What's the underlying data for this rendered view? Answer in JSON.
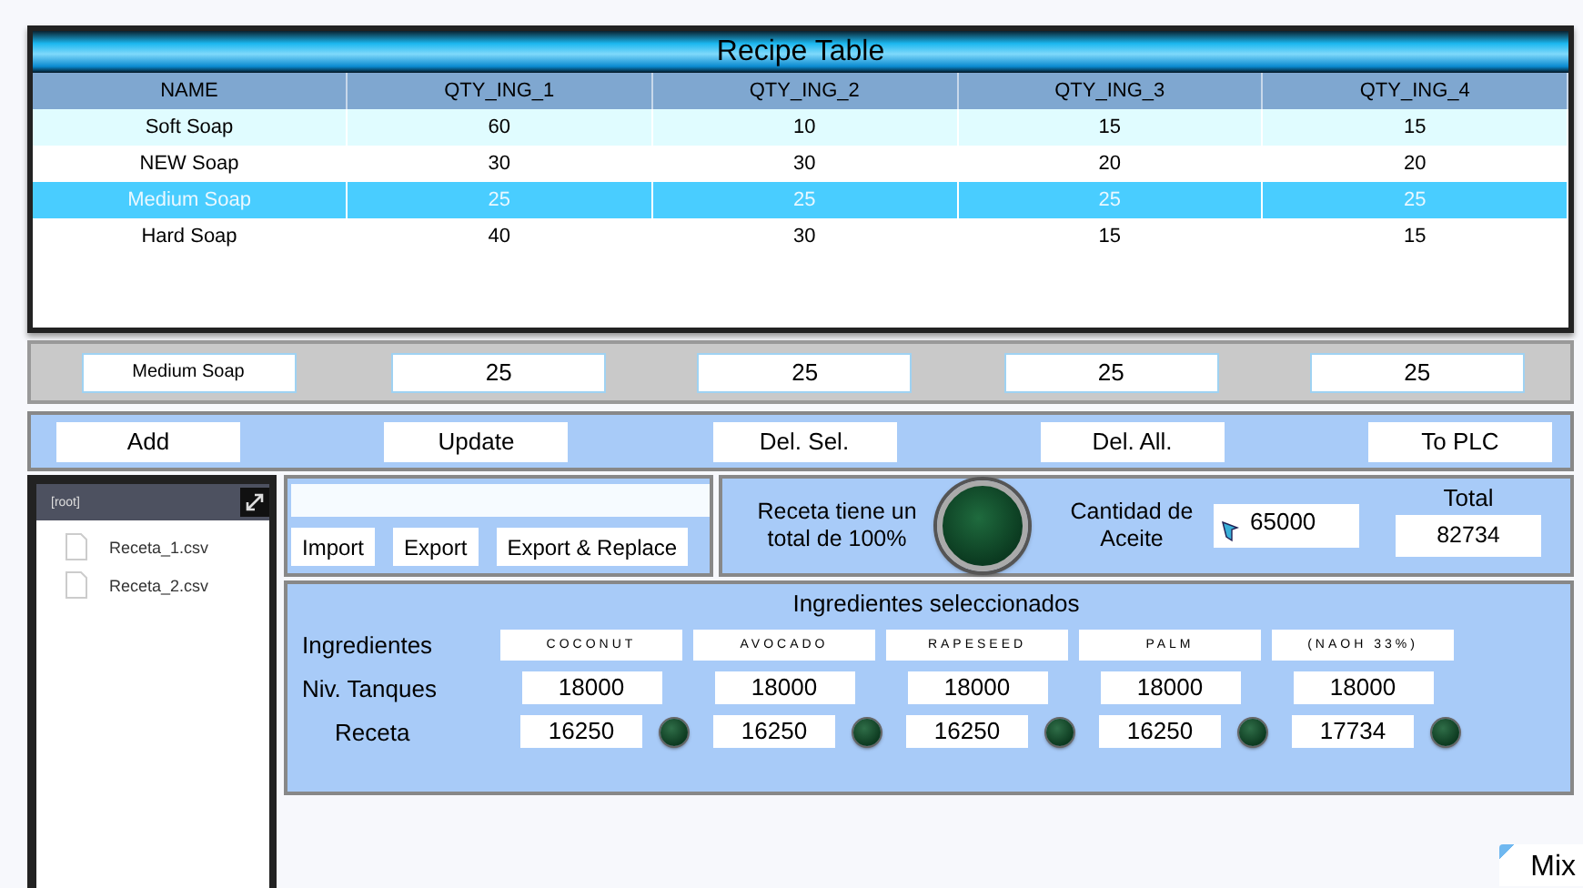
{
  "recipe_table": {
    "title": "Recipe Table",
    "columns": [
      "NAME",
      "QTY_ING_1",
      "QTY_ING_2",
      "QTY_ING_3",
      "QTY_ING_4"
    ],
    "rows": [
      {
        "cells": [
          "Soft Soap",
          "60",
          "10",
          "15",
          "15"
        ],
        "selected": false
      },
      {
        "cells": [
          "NEW Soap",
          "30",
          "30",
          "20",
          "20"
        ],
        "selected": false
      },
      {
        "cells": [
          "Medium Soap",
          "25",
          "25",
          "25",
          "25"
        ],
        "selected": true
      },
      {
        "cells": [
          "Hard Soap",
          "40",
          "30",
          "15",
          "15"
        ],
        "selected": false
      }
    ]
  },
  "edit_fields": [
    "Medium Soap",
    "25",
    "25",
    "25",
    "25"
  ],
  "actions": [
    "Add",
    "Update",
    "Del. Sel.",
    "Del. All.",
    "To PLC"
  ],
  "file_tree": {
    "root": "[root]",
    "files": [
      "Receta_1.csv",
      "Receta_2.csv"
    ]
  },
  "file_panel": {
    "buttons": [
      "Import",
      "Export",
      "Export & Replace"
    ]
  },
  "status": {
    "message": "Receta tiene un total de 100%",
    "lamp_lit": false,
    "oil_label": "Cantidad de Aceite",
    "oil_value": "65000",
    "total_label": "Total",
    "total_value": "82734"
  },
  "ingredients": {
    "title": "Ingredientes seleccionados",
    "row_labels": [
      "Ingredientes",
      "Niv. Tanques",
      "Receta"
    ],
    "items": [
      {
        "name": "COCONUT",
        "tank": "18000",
        "recipe": "16250",
        "lit": false
      },
      {
        "name": "AVOCADO",
        "tank": "18000",
        "recipe": "16250",
        "lit": false
      },
      {
        "name": "RAPESEED",
        "tank": "18000",
        "recipe": "16250",
        "lit": false
      },
      {
        "name": "PALM",
        "tank": "18000",
        "recipe": "16250",
        "lit": false
      },
      {
        "name": "(NAOH 33%)",
        "tank": "18000",
        "recipe": "17734",
        "lit": false
      }
    ]
  },
  "mix_button": "Mix"
}
